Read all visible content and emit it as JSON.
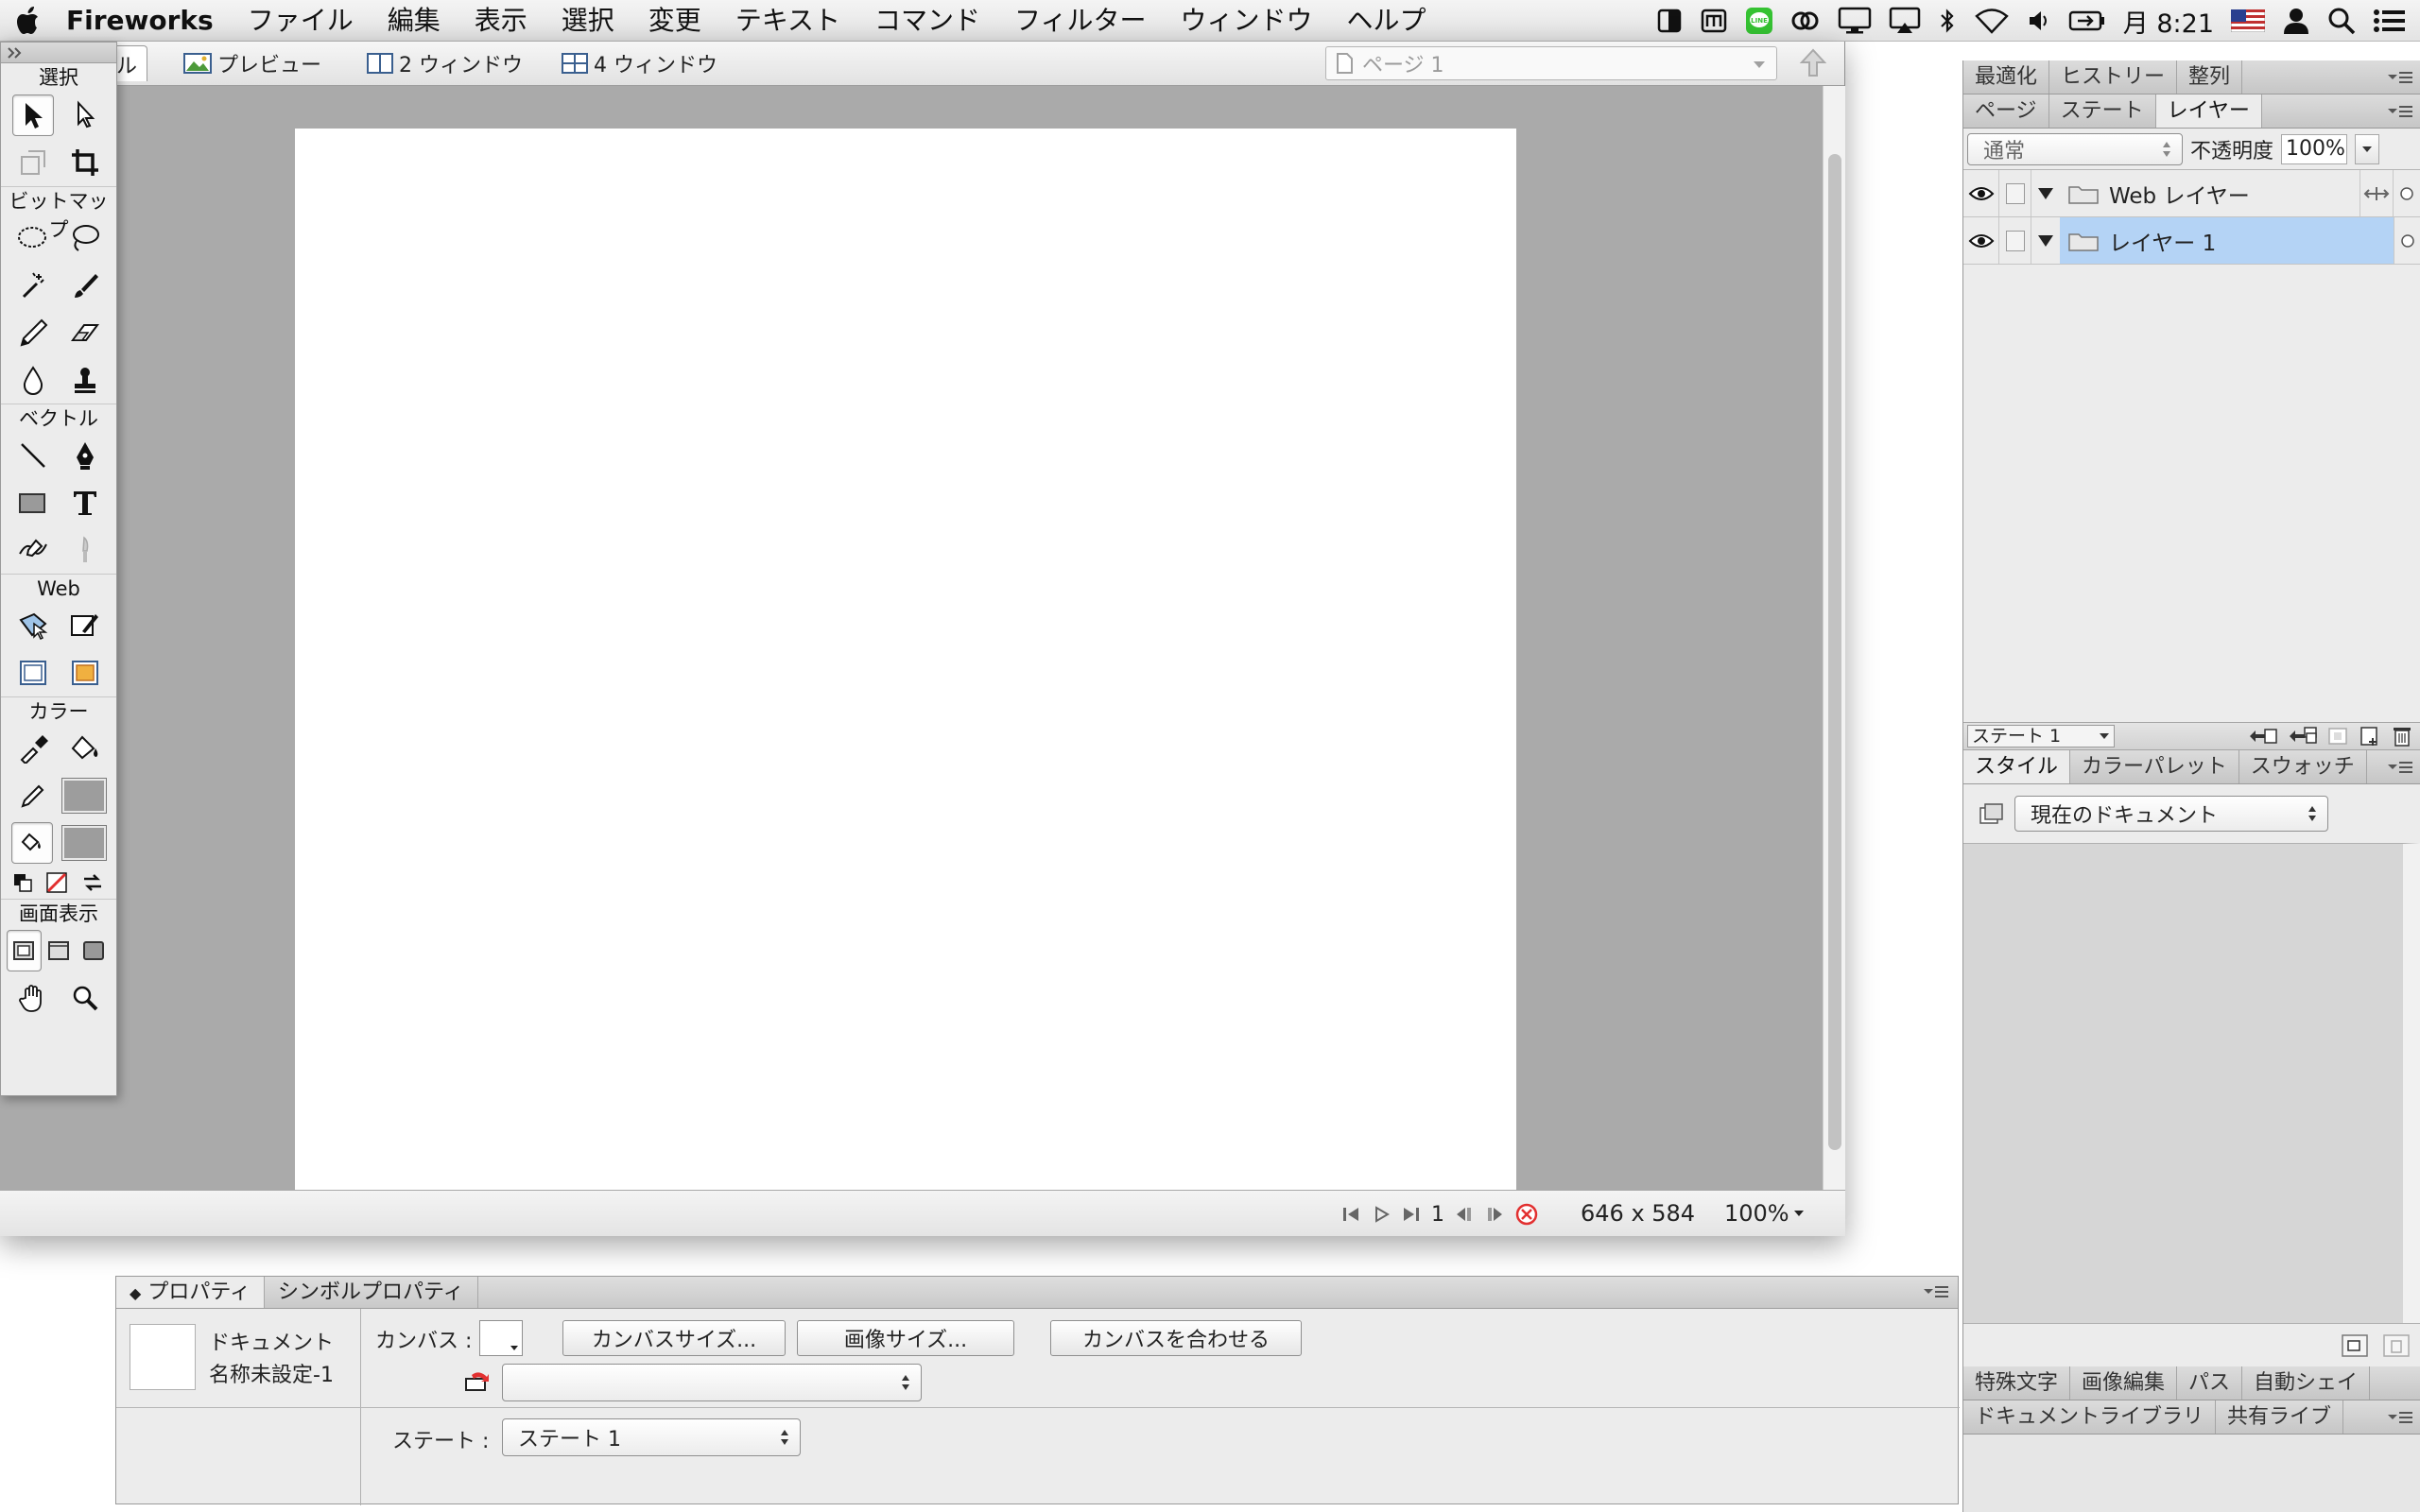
{
  "menubar": {
    "app_name": "Fireworks",
    "items": [
      "ファイル",
      "編集",
      "表示",
      "選択",
      "変更",
      "テキスト",
      "コマンド",
      "フィルター",
      "ウィンドウ",
      "ヘルプ"
    ],
    "clock": "月 8:21"
  },
  "doc_window": {
    "tabs": {
      "original_partial": "ル",
      "preview": "プレビュー",
      "two_window": "2 ウィンドウ",
      "four_window": "4 ウィンドウ"
    },
    "page_select": "ページ 1",
    "status": {
      "frame": "1",
      "dimensions": "646 x 584",
      "zoom": "100%"
    }
  },
  "tools": {
    "sections": {
      "select": "選択",
      "bitmap": "ビットマップ",
      "vector": "ベクトル",
      "web": "Web",
      "colors": "カラー",
      "view": "画面表示"
    }
  },
  "properties": {
    "tabs": {
      "properties": "プロパティ",
      "symbol_properties": "シンボルプロパティ"
    },
    "doc_type": "ドキュメント",
    "doc_name": "名称未設定-1",
    "canvas_label": "カンバス :",
    "canvas_size_btn": "カンバスサイズ...",
    "image_size_btn": "画像サイズ...",
    "fit_canvas_btn": "カンバスを合わせる",
    "state_label": "ステート :",
    "state_value": "ステート 1"
  },
  "panels": {
    "top_tabs": [
      "最適化",
      "ヒストリー",
      "整列"
    ],
    "layer_tabs": [
      "ページ",
      "ステート",
      "レイヤー"
    ],
    "blend_mode": "通常",
    "opacity_label": "不透明度",
    "opacity_value": "100%",
    "layers": [
      {
        "name": "Web レイヤー"
      },
      {
        "name": "レイヤー 1"
      }
    ],
    "state_footer": "ステート 1",
    "style_tabs": [
      "スタイル",
      "カラーパレット",
      "スウォッチ"
    ],
    "styles_select": "現在のドキュメント",
    "bottom_tabs_1": [
      "特殊文字",
      "画像編集",
      "パス",
      "自動シェイ"
    ],
    "bottom_tabs_2": [
      "ドキュメントライブラリ",
      "共有ライブ"
    ]
  },
  "colors": {
    "canvas_bg": "#aaaaaa",
    "selection": "#b4d3f5",
    "stroke_red": "#e23030",
    "line_green": "#35c232"
  }
}
